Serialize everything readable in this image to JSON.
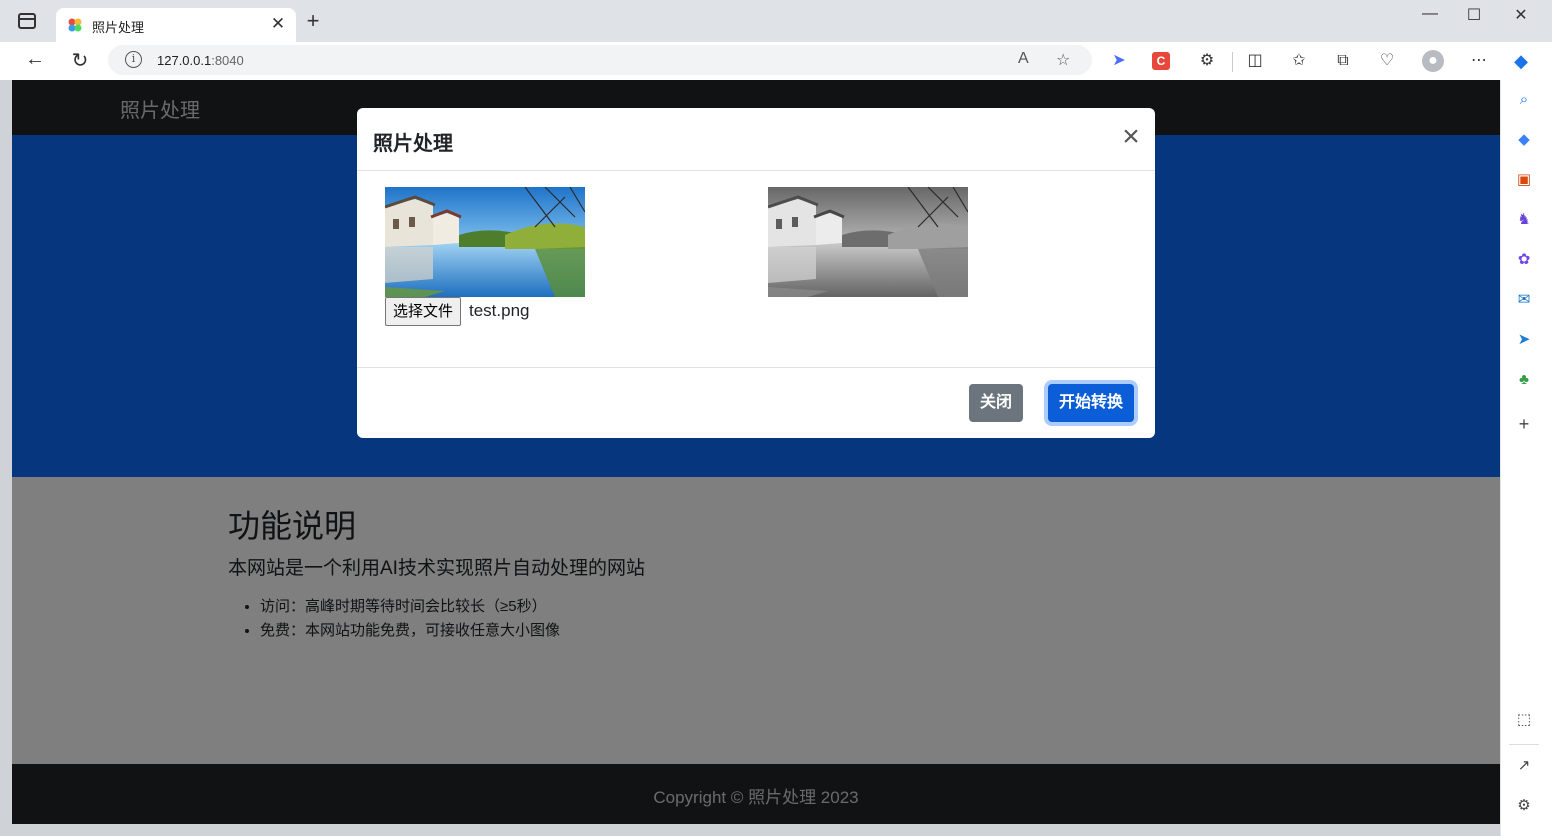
{
  "browser": {
    "tab_title": "照片处理",
    "tab_close": "✕",
    "new_tab": "+",
    "address_host": "127.0.0.1",
    "address_port": ":8040",
    "read_aloud": "A",
    "window_minimize": "—",
    "window_maximize": "☐",
    "window_close": "✕"
  },
  "page": {
    "brand": "照片处理",
    "features": {
      "title": "功能说明",
      "lead": "本网站是一个利用AI技术实现照片自动处理的网站",
      "items": [
        "访问：高峰时期等待时间会比较长（≥5秒）",
        "免费：本网站功能免费，可接收任意大小图像"
      ]
    },
    "copyright": "Copyright © 照片处理 2023"
  },
  "modal": {
    "title": "照片处理",
    "close_symbol": "×",
    "file_button": "选择文件",
    "file_name": "test.png",
    "close_button": "关闭",
    "convert_button": "开始转换"
  },
  "colors": {
    "navbar": "#212529",
    "hero": "#0d6efd",
    "close_button": "#6c757d",
    "convert_button": "#0b5ed7"
  }
}
